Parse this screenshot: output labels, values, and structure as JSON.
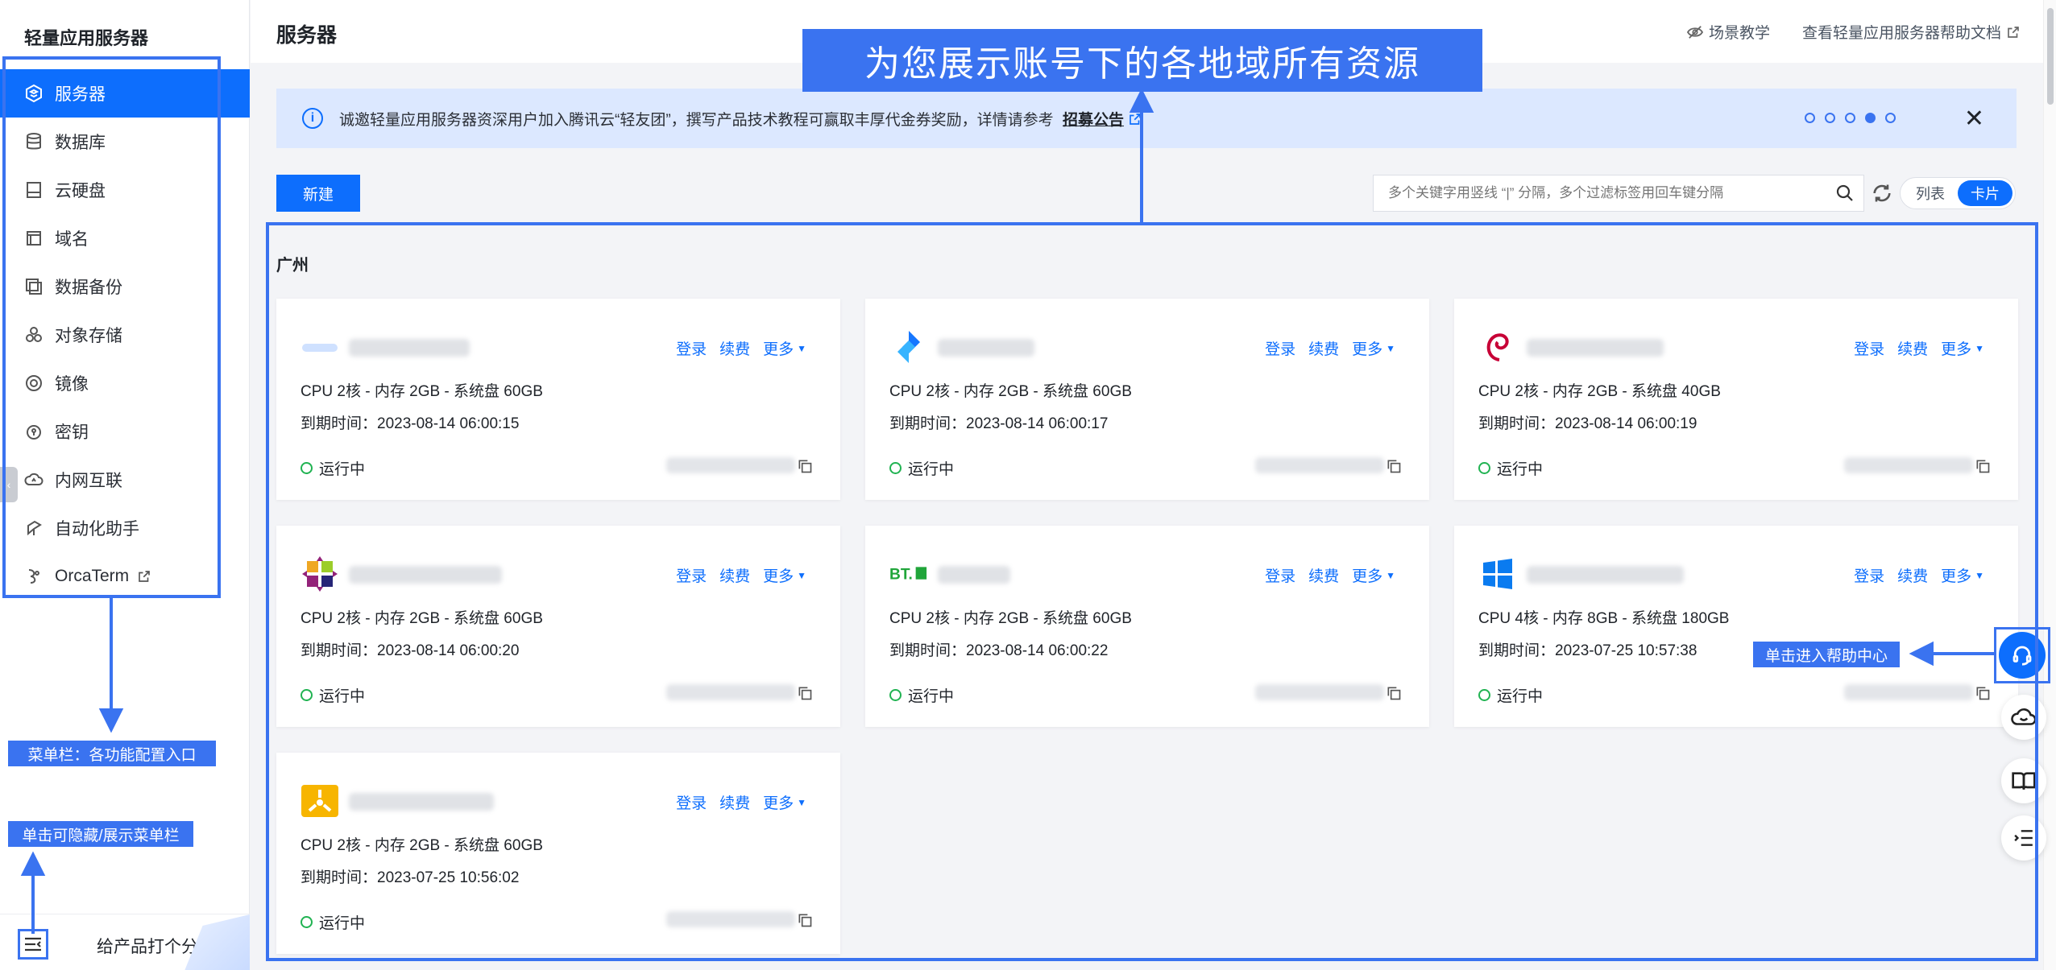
{
  "sidebar": {
    "title": "轻量应用服务器",
    "items": [
      {
        "label": "服务器",
        "icon": "server-icon"
      },
      {
        "label": "数据库",
        "icon": "database-icon"
      },
      {
        "label": "云硬盘",
        "icon": "disk-icon"
      },
      {
        "label": "域名",
        "icon": "domain-icon"
      },
      {
        "label": "数据备份",
        "icon": "backup-icon"
      },
      {
        "label": "对象存储",
        "icon": "storage-icon"
      },
      {
        "label": "镜像",
        "icon": "image-icon"
      },
      {
        "label": "密钥",
        "icon": "key-icon"
      },
      {
        "label": "内网互联",
        "icon": "network-icon"
      },
      {
        "label": "自动化助手",
        "icon": "automation-icon"
      },
      {
        "label": "OrcaTerm",
        "icon": "terminal-icon"
      }
    ],
    "footer_rate": "给产品打个分"
  },
  "header": {
    "title": "服务器",
    "links": [
      "场景教学",
      "查看轻量应用服务器帮助文档"
    ]
  },
  "notice": {
    "text": "诚邀轻量应用服务器资深用户加入腾讯云“轻友团”，撰写产品技术教程可赢取丰厚代金券奖励，详情请参考",
    "link": "招募公告",
    "active_dot": 4,
    "dot_count": 5
  },
  "toolbar": {
    "new_button": "新建",
    "search_placeholder": "多个关键字用竖线 “|” 分隔，多个过滤标签用回车键分隔",
    "view_list": "列表",
    "view_card": "卡片"
  },
  "region": "广州",
  "card_actions": {
    "login": "登录",
    "renew": "续费",
    "more": "更多"
  },
  "instances": [
    {
      "spec": "CPU 2核 - 内存 2GB - 系统盘 60GB",
      "expire": "到期时间：2023-08-14 06:00:15",
      "status": "运行中",
      "logo": "cloud-logo-icon"
    },
    {
      "spec": "CPU 2核 - 内存 2GB - 系统盘 60GB",
      "expire": "到期时间：2023-08-14 06:00:17",
      "status": "运行中",
      "logo": "app-logo-icon"
    },
    {
      "spec": "CPU 2核 - 内存 2GB - 系统盘 40GB",
      "expire": "到期时间：2023-08-14 06:00:19",
      "status": "运行中",
      "logo": "debian-logo-icon"
    },
    {
      "spec": "CPU 2核 - 内存 2GB - 系统盘 60GB",
      "expire": "到期时间：2023-08-14 06:00:20",
      "status": "运行中",
      "logo": "centos-logo-icon"
    },
    {
      "spec": "CPU 2核 - 内存 2GB - 系统盘 60GB",
      "expire": "到期时间：2023-08-14 06:00:22",
      "status": "运行中",
      "logo": "bt-panel-logo-icon"
    },
    {
      "spec": "CPU 4核 - 内存 8GB - 系统盘 180GB",
      "expire": "到期时间：2023-07-25 10:57:38",
      "status": "运行中",
      "logo": "windows-logo-icon"
    },
    {
      "spec": "CPU 2核 - 内存 2GB - 系统盘 60GB",
      "expire": "到期时间：2023-07-25 10:56:02",
      "status": "运行中",
      "logo": "ubuntu-logo-icon"
    }
  ],
  "annotations": {
    "top_banner": "为您展示账号下的各地域所有资源",
    "menu_bar": "菜单栏：各功能配置入口",
    "toggle_menu": "单击可隐藏/展示菜单栏",
    "help_center": "单击进入帮助中心"
  },
  "colors": {
    "accent": "#0d6efd",
    "annotation": "#3a73f0",
    "running": "#21b352"
  }
}
